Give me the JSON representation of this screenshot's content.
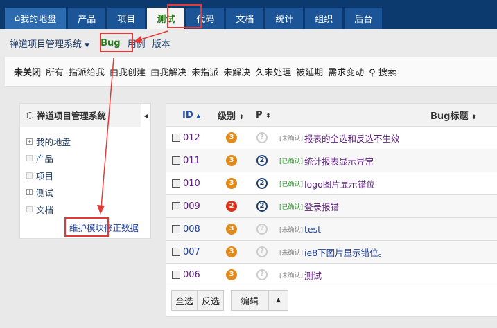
{
  "topnav": {
    "tabs": [
      "我的地盘",
      "产品",
      "项目",
      "测试",
      "代码",
      "文档",
      "统计",
      "组织",
      "后台"
    ],
    "active": 3
  },
  "subnav": {
    "product": "禅道项目管理系统",
    "items": [
      "Bug",
      "用例",
      "版本"
    ]
  },
  "filters": {
    "items": [
      "未关闭",
      "所有",
      "指派给我",
      "由我创建",
      "由我解决",
      "未指派",
      "未解决",
      "久未处理",
      "被延期",
      "需求变动"
    ],
    "search": "搜索"
  },
  "sidebar": {
    "title": "禅道项目管理系统",
    "items": [
      {
        "label": "我的地盘",
        "expand": true
      },
      {
        "label": "产品",
        "expand": false
      },
      {
        "label": "项目",
        "expand": false
      },
      {
        "label": "测试",
        "expand": true
      },
      {
        "label": "文档",
        "expand": false
      }
    ],
    "manage": "维护模块",
    "fix": "修正数据"
  },
  "table": {
    "headers": {
      "id": "ID",
      "severity": "级别",
      "pri": "P",
      "title": "Bug标题"
    },
    "rows": [
      {
        "id": "012",
        "severity": "3",
        "pri": "?",
        "status": "[未确认]",
        "title": "报表的全选和反选不生效"
      },
      {
        "id": "011",
        "severity": "3",
        "pri": "2",
        "status": "[已确认]",
        "title": "统计报表显示异常"
      },
      {
        "id": "010",
        "severity": "3",
        "pri": "2",
        "status": "[已确认]",
        "title": "logo图片显示错位"
      },
      {
        "id": "009",
        "severity": "2",
        "pri": "2",
        "status": "[已确认]",
        "title": "登录报错"
      },
      {
        "id": "008",
        "severity": "3",
        "pri": "?",
        "status": "[未确认]",
        "title": "test"
      },
      {
        "id": "007",
        "severity": "3",
        "pri": "?",
        "status": "[未确认]",
        "title": "ie8下图片显示错位。"
      },
      {
        "id": "006",
        "severity": "3",
        "pri": "?",
        "status": "[未确认]",
        "title": "测试"
      }
    ],
    "buttons": {
      "select_all": "全选",
      "invert": "反选",
      "edit": "编辑"
    }
  },
  "colors": {
    "sev3": "#e08a1e",
    "sev2": "#d9341c",
    "pri": "#1f3f6b",
    "annotation": "#e53935"
  }
}
